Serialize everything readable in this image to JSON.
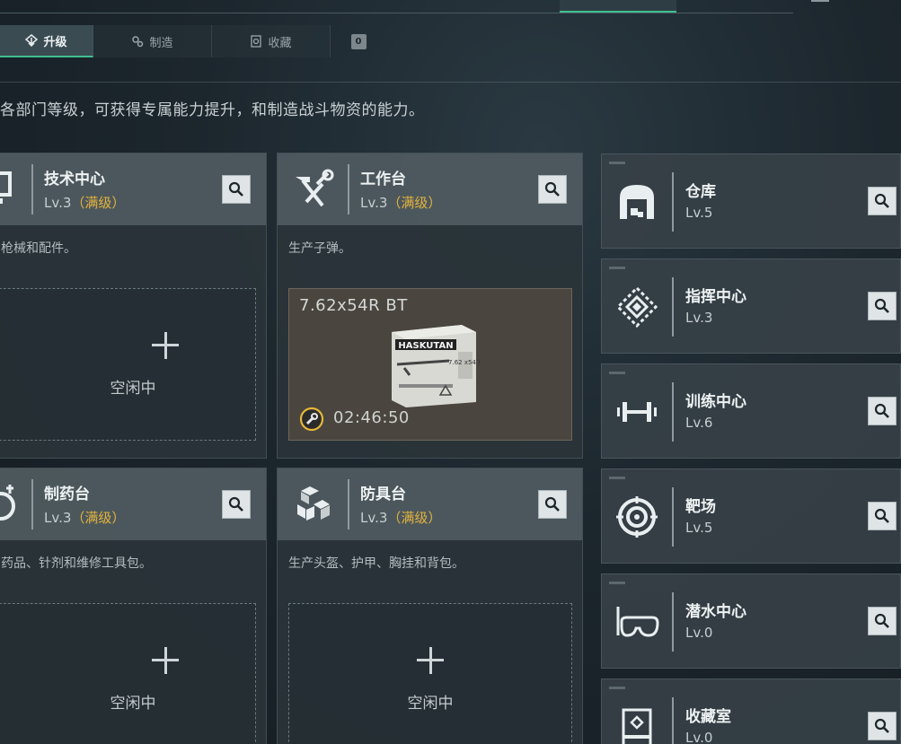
{
  "tabs": [
    {
      "label": "升级",
      "icon": "upgrade-icon"
    },
    {
      "label": "制造",
      "icon": "craft-icon"
    },
    {
      "label": "收藏",
      "icon": "collection-icon"
    }
  ],
  "tab_badge": "0",
  "intro_text": "各部门等级，可获得专属能力提升，和制造战斗物资的能力。",
  "cards": {
    "tech": {
      "name": "技术中心",
      "level": "Lv.3",
      "max": "（满级）",
      "desc": "枪械和配件。",
      "idle": "空闲中",
      "icon": "computer-icon"
    },
    "workbench": {
      "name": "工作台",
      "level": "Lv.3",
      "max": "（满级）",
      "desc": "生产子弹。",
      "icon": "hammer-wrench-icon",
      "production": {
        "item": "7.62x54R BT",
        "timer": "02:46:50",
        "box_brand": "HASKUTAN",
        "box_label": "7.62 x54 R"
      }
    },
    "pharmacy": {
      "name": "制药台",
      "level": "Lv.3",
      "max": "（满级）",
      "desc": "药品、针剂和维修工具包。",
      "idle": "空闲中",
      "icon": "flask-icon"
    },
    "armor": {
      "name": "防具台",
      "level": "Lv.3",
      "max": "（满级）",
      "desc": "生产头盔、护甲、胸挂和背包。",
      "idle": "空闲中",
      "icon": "cubes-icon"
    }
  },
  "side_list": [
    {
      "name": "仓库",
      "level": "Lv.5",
      "icon": "warehouse-icon"
    },
    {
      "name": "指挥中心",
      "level": "Lv.3",
      "icon": "command-emblem-icon"
    },
    {
      "name": "训练中心",
      "level": "Lv.6",
      "icon": "dumbbell-icon"
    },
    {
      "name": "靶场",
      "level": "Lv.5",
      "icon": "target-icon"
    },
    {
      "name": "潜水中心",
      "level": "Lv.0",
      "icon": "diving-mask-icon"
    },
    {
      "name": "收藏室",
      "level": "Lv.0",
      "icon": "trophy-case-icon"
    }
  ]
}
